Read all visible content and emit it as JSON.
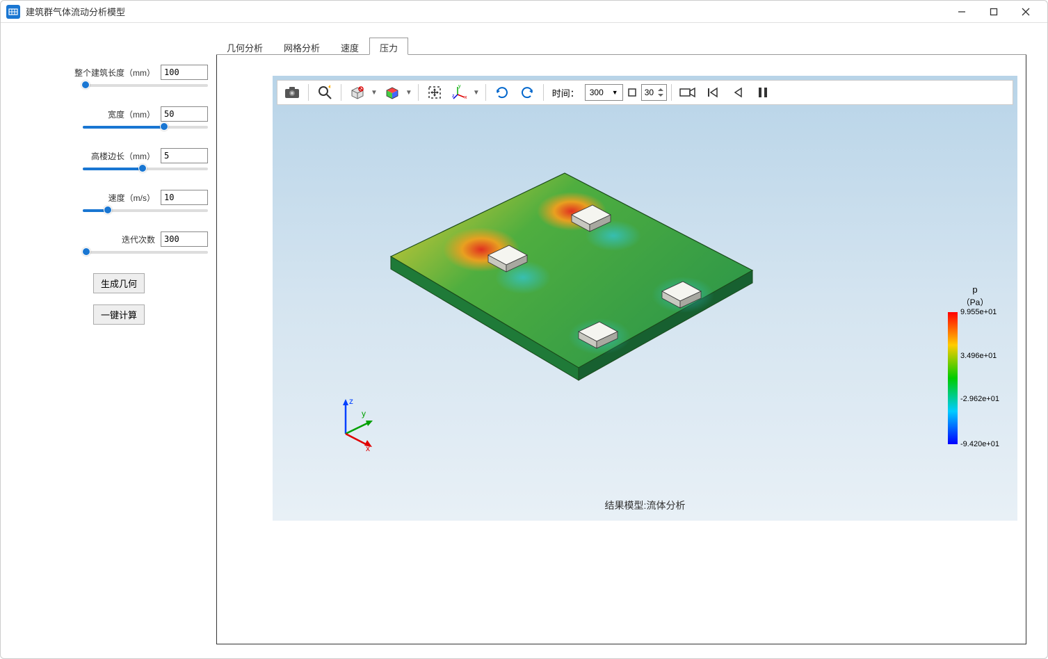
{
  "window": {
    "title": "建筑群气体流动分析模型"
  },
  "sidebar": {
    "params": [
      {
        "label": "整个建筑长度（mm）",
        "value": "100",
        "slider_pct": 2
      },
      {
        "label": "宽度（mm）",
        "value": "50",
        "slider_pct": 65
      },
      {
        "label": "高楼边长（mm）",
        "value": "5",
        "slider_pct": 48
      },
      {
        "label": "速度（m/s）",
        "value": "10",
        "slider_pct": 20
      },
      {
        "label": "迭代次数",
        "value": "300",
        "slider_pct": 3
      }
    ],
    "buttons": {
      "generate": "生成几何",
      "compute": "一键计算"
    }
  },
  "tabs": {
    "items": [
      "几何分析",
      "网格分析",
      "速度",
      "压力"
    ],
    "active_index": 3
  },
  "toolbar": {
    "time_label": "时间：",
    "time_combo": "300",
    "frame_spin": "30"
  },
  "viewport": {
    "caption": "结果模型:流体分析",
    "axes": {
      "x": "x",
      "y": "y",
      "z": "z"
    }
  },
  "legend": {
    "title": "p",
    "unit": "（Pa）",
    "ticks": [
      {
        "v": "9.955e+01",
        "pos": 0
      },
      {
        "v": "3.496e+01",
        "pos": 33
      },
      {
        "v": "-2.962e+01",
        "pos": 66
      },
      {
        "v": "-9.420e+01",
        "pos": 100
      }
    ]
  },
  "chart_data": {
    "type": "heatmap",
    "title": "结果模型:流体分析",
    "variable": "p",
    "unit": "Pa",
    "colorbar_range": [
      -94.2,
      99.55
    ],
    "colorbar_ticks": [
      99.55,
      34.96,
      -29.62,
      -94.2
    ],
    "description": "3D isometric pressure-contour plate with four raised building blocks; high pressure (red/yellow) upstream of blocks, low pressure (cyan/blue) wakes downstream, ambient green elsewhere."
  }
}
